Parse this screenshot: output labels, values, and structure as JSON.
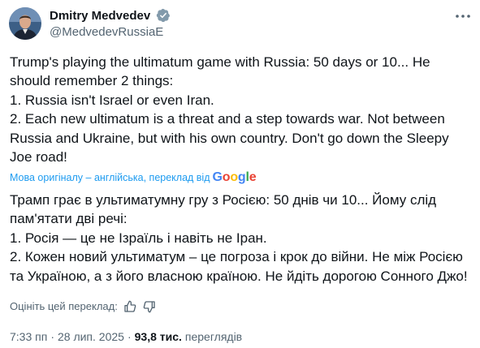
{
  "author": {
    "display_name": "Dmitry Medvedev",
    "handle": "@MedvedevRussiaE",
    "avatar_icon": "avatar-photo",
    "verified_icon": "verified-badge-icon"
  },
  "post": {
    "text": "Trump's playing the ultimatum game with Russia: 50 days or 10... He should remember 2 things:\n1. Russia isn't Israel or even Iran.\n2. Each new ultimatum is a threat and a step towards war. Not between Russia and Ukraine, but with his own country. Don't go down the Sleepy Joe road!",
    "translate_label": "Мова оригіналу – англійська, переклад від",
    "translate_provider": "Google",
    "translated_text": "Трамп грає в ультиматумну гру з Росією: 50 днів чи 10... Йому слід пам'ятати дві речі:\n1. Росія — це не Ізраїль і навіть не Іран.\n2. Кожен новий ультиматум – це погроза і крок до війни. Не між Росією та Україною, а з його власною країною. Не йдіть дорогою Сонного Джо!",
    "rate_translation_label": "Оцініть цей переклад:"
  },
  "meta": {
    "time": "7:33 пп",
    "separator": "·",
    "date": "28 лип. 2025",
    "views_count": "93,8 тис.",
    "views_label": "переглядів"
  },
  "colors": {
    "text": "#0f1419",
    "secondary": "#536471",
    "link": "#1d9bf0",
    "verified": "#829aab"
  }
}
